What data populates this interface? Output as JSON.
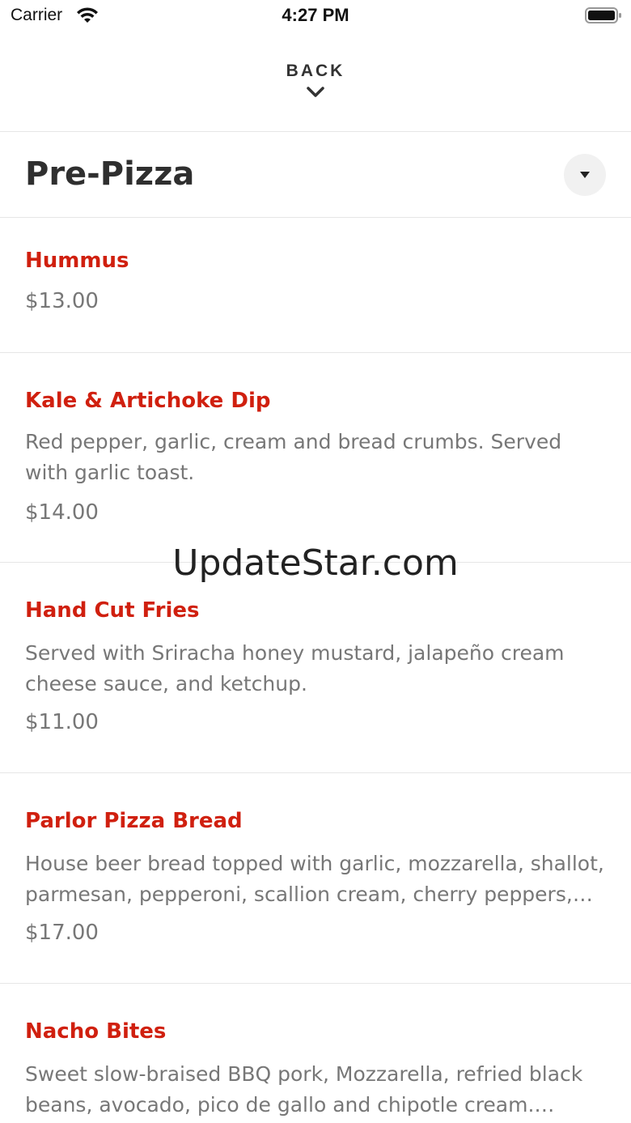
{
  "status_bar": {
    "carrier": "Carrier",
    "time": "4:27 PM"
  },
  "header": {
    "back_label": "BACK"
  },
  "section": {
    "title": "Pre-Pizza"
  },
  "menu": {
    "items": [
      {
        "name": "Hummus",
        "description": "",
        "price": "$13.00"
      },
      {
        "name": "Kale & Artichoke Dip",
        "description": "Red pepper, garlic, cream and bread crumbs. Served with garlic toast.",
        "price": "$14.00"
      },
      {
        "name": "Hand Cut Fries",
        "description": "Served with Sriracha honey mustard, jalapeño cream cheese sauce, and ketchup.",
        "price": "$11.00"
      },
      {
        "name": "Parlor Pizza Bread",
        "description": "House beer bread topped with garlic, mozzarella, shallot, parmesan, pepperoni, scallion cream, cherry peppers, an...",
        "price": "$17.00"
      },
      {
        "name": "Nacho Bites",
        "description": "Sweet slow-braised BBQ pork, Mozzarella, refried black beans, avocado, pico de gallo and chipotle cream. Contai...",
        "price": ""
      }
    ]
  },
  "watermark": "UpdateStar.com",
  "colors": {
    "item_name": "#d0200f",
    "secondary_text": "#777777",
    "title_text": "#2f2f2f"
  }
}
